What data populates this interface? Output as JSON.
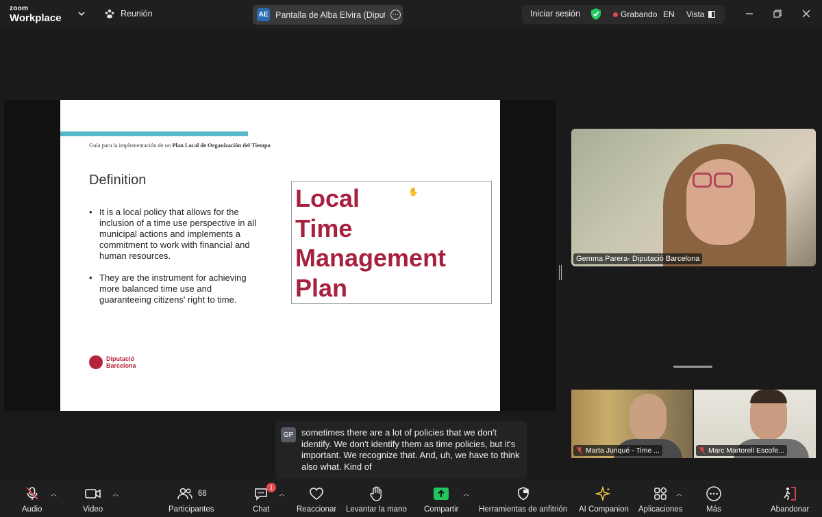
{
  "app": {
    "logo_line1": "zoom",
    "logo_line2": "Workplace"
  },
  "header": {
    "meeting_label": "Reunión",
    "share_initials": "AE",
    "share_label": "Pantalla de Alba Elvira (Diputació",
    "login_label": "Iniciar sesión",
    "recording_label": "Grabando",
    "language": "EN",
    "view_label": "Vista"
  },
  "slide": {
    "guide_prefix": "Guía para la implementación de un ",
    "guide_bold": "Plan Local de Organización del Tiempo",
    "heading": "Definition",
    "bullets": [
      "It is a local policy that allows for the inclusion of a time use perspective in all municipal actions and implements a commitment to work with financial and human resources.",
      "They are the instrument for achieving more balanced time use and guaranteeing citizens' right to time."
    ],
    "title_lines": [
      "Local",
      "Time",
      "Management",
      "Plan"
    ],
    "logo_line1": "Diputació",
    "logo_line2": "Barcelona",
    "accent_color": "#a7213f",
    "bar_color": "#57b8c9"
  },
  "participants": {
    "speaker_name": "Gemma Parera- Diputació Barcelona",
    "tile2_name": "Marta Junqué - Time ...",
    "tile3_name": "Marc Martorell Escofe..."
  },
  "caption": {
    "initials": "GP",
    "text": "sometimes there are a lot of policies that we don't identify. We don't identify them as time policies, but it's important. We recognize that. And, uh, we have to think also what. Kind of"
  },
  "toolbar": {
    "audio": "Audio",
    "video": "Video",
    "participants": "Participantes",
    "participants_count": "68",
    "chat": "Chat",
    "chat_badge": "1",
    "react": "Reaccionar",
    "raise_hand": "Levantar la mano",
    "share": "Compartir",
    "host_tools": "Herramientas de anfitrión",
    "ai": "AI Companion",
    "apps": "Aplicaciones",
    "more": "Más",
    "leave": "Abandonar"
  }
}
